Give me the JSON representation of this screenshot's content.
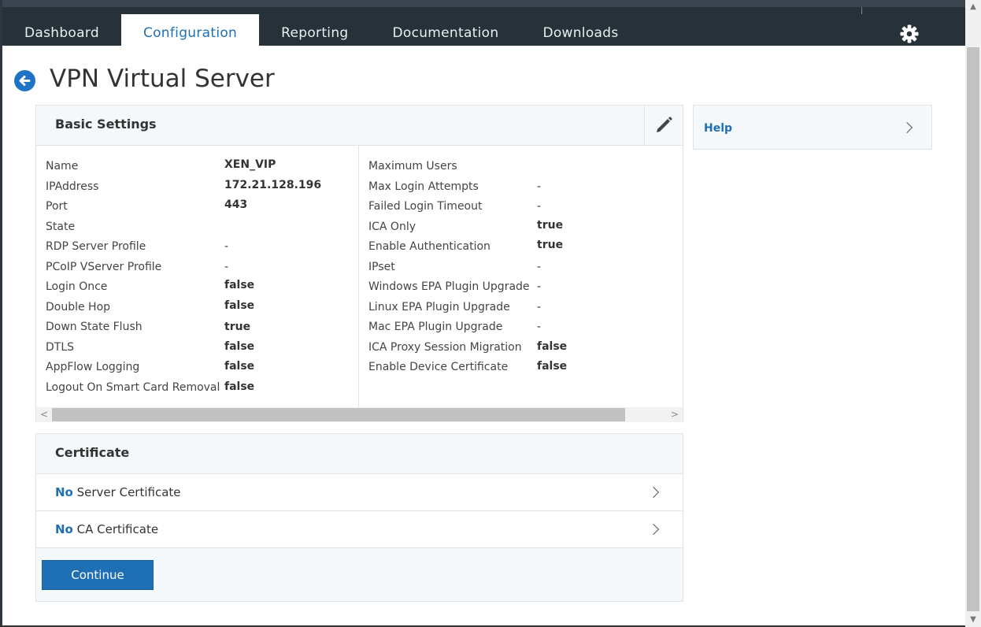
{
  "nav": {
    "items": [
      {
        "label": "Dashboard",
        "active": false
      },
      {
        "label": "Configuration",
        "active": true
      },
      {
        "label": "Reporting",
        "active": false
      },
      {
        "label": "Documentation",
        "active": false
      },
      {
        "label": "Downloads",
        "active": false
      }
    ],
    "settings_icon": "gear-icon"
  },
  "page": {
    "title": "VPN Virtual Server",
    "back_icon": "back-arrow-icon"
  },
  "basic_settings": {
    "title": "Basic Settings",
    "edit_icon": "pencil-icon",
    "left": [
      {
        "label": "Name",
        "value": "XEN_VIP"
      },
      {
        "label": "IPAddress",
        "value": "172.21.128.196"
      },
      {
        "label": "Port",
        "value": "443"
      },
      {
        "label": "State",
        "value": ""
      },
      {
        "label": "RDP Server Profile",
        "value": "-"
      },
      {
        "label": "PCoIP VServer Profile",
        "value": "-"
      },
      {
        "label": "Login Once",
        "value": "false"
      },
      {
        "label": "Double Hop",
        "value": "false"
      },
      {
        "label": "Down State Flush",
        "value": "true"
      },
      {
        "label": "DTLS",
        "value": "false"
      },
      {
        "label": "AppFlow Logging",
        "value": "false"
      },
      {
        "label": "Logout On Smart Card Removal",
        "value": "false"
      }
    ],
    "right": [
      {
        "label": "Maximum Users",
        "value": ""
      },
      {
        "label": "Max Login Attempts",
        "value": "-"
      },
      {
        "label": "Failed Login Timeout",
        "value": "-"
      },
      {
        "label": "ICA Only",
        "value": "true"
      },
      {
        "label": "Enable Authentication",
        "value": "true"
      },
      {
        "label": "IPset",
        "value": "-"
      },
      {
        "label": "Windows EPA Plugin Upgrade",
        "value": "-"
      },
      {
        "label": "Linux EPA Plugin Upgrade",
        "value": "-"
      },
      {
        "label": "Mac EPA Plugin Upgrade",
        "value": "-"
      },
      {
        "label": "ICA Proxy Session Migration",
        "value": "false"
      },
      {
        "label": "Enable Device Certificate",
        "value": "false"
      }
    ]
  },
  "help": {
    "label": "Help"
  },
  "certificate": {
    "title": "Certificate",
    "rows": [
      {
        "prefix": "No",
        "text": "Server Certificate"
      },
      {
        "prefix": "No",
        "text": "CA Certificate"
      }
    ],
    "continue_label": "Continue"
  },
  "colors": {
    "topbar": "#263238",
    "accent": "#1f6fb5",
    "panel_header": "#f5f8fa"
  }
}
